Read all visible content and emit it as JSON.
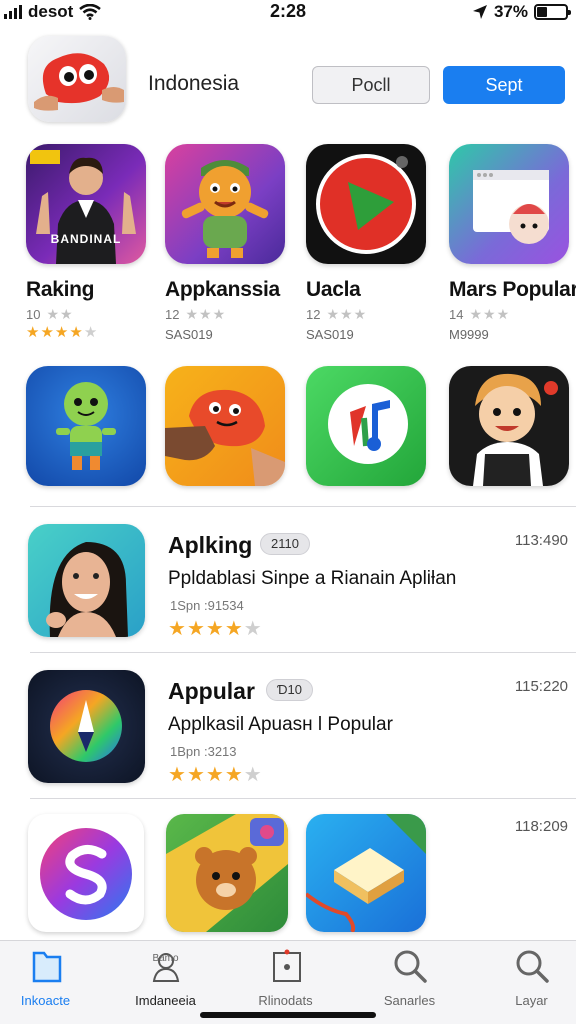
{
  "status_bar": {
    "carrier": "desot",
    "time": "2:28",
    "battery": "37%",
    "battery_level": 0.37
  },
  "header": {
    "title": "Indonesia",
    "button_secondary": "Pocll",
    "button_primary": "Sept"
  },
  "grid_apps": [
    {
      "name": "Raking",
      "count": "10",
      "price": "",
      "stars": 4
    },
    {
      "name": "Appkanssia",
      "count": "12",
      "price": "SAS019",
      "stars": 0
    },
    {
      "name": "Uacla",
      "count": "12",
      "price": "SAS019",
      "stars": 0
    },
    {
      "name": "Mars Popular",
      "count": "14",
      "price": "M9999",
      "stars": 0
    }
  ],
  "raking_icon_text": "BANDINAL",
  "list_apps": [
    {
      "title": "Aplking",
      "badge": "2110",
      "description": "Ppldablasi Sinpe a Rianain Apliƚan",
      "meta": "1Spn :91534",
      "stars": 4,
      "time": "113:490"
    },
    {
      "title": "Appular",
      "badge": "Ɗ10",
      "description": "Applkasil Apuasн l Popular",
      "meta": "1Bpn :3213",
      "stars": 4,
      "time": "115:220"
    }
  ],
  "bottom_time": "118:209",
  "tabs": [
    {
      "label": "Inkoacte",
      "icon": "folder-icon"
    },
    {
      "label": "Imdaneeia",
      "icon": "person-icon",
      "sub": "Bamo"
    },
    {
      "label": "Rlinodats",
      "icon": "frame-icon"
    },
    {
      "label": "Sanarles",
      "icon": "search-icon"
    },
    {
      "label": "Layar",
      "icon": "search-icon"
    }
  ],
  "colors": {
    "accent": "#1a7ef0",
    "star": "#f5a623"
  }
}
